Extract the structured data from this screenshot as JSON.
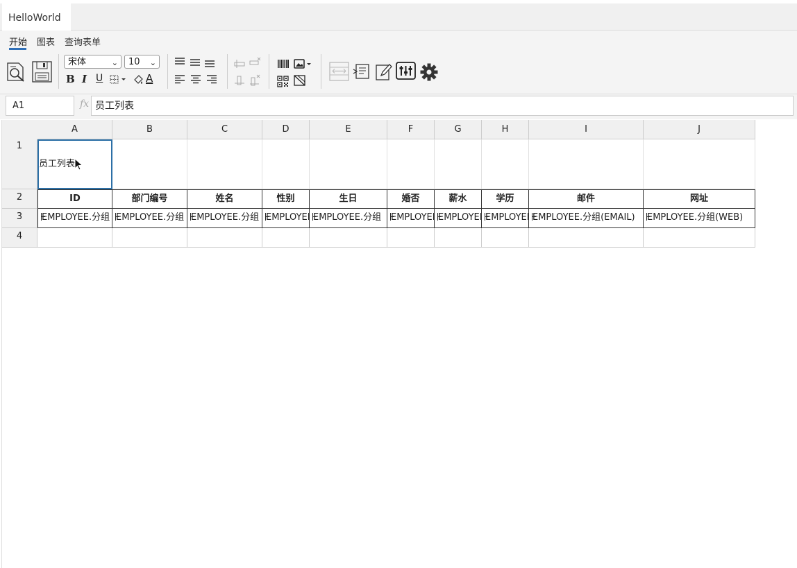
{
  "window": {
    "doc_tab": "HelloWorld"
  },
  "ribbon": {
    "tabs": [
      "开始",
      "图表",
      "查询表单"
    ],
    "active_index": 0
  },
  "toolbar": {
    "font_name": "宋体",
    "font_size": "10",
    "bold": "B",
    "italic": "I",
    "underline": "U",
    "font_color": "A",
    "icons": [
      "preview-icon",
      "save-icon",
      "align-top-icon",
      "align-middle-icon",
      "align-bottom-icon",
      "align-left-icon",
      "align-center-icon",
      "align-right-icon",
      "insert-row-icon",
      "delete-row-icon",
      "insert-col-icon",
      "delete-col-icon",
      "barcode-icon",
      "image-icon",
      "qrcode-icon",
      "slash-icon",
      "merge-icon",
      "datasource-icon",
      "edit-icon",
      "params-icon",
      "settings-icon"
    ]
  },
  "formula_bar": {
    "cell_ref": "A1",
    "fx": "fx",
    "content": "员工列表"
  },
  "sheet": {
    "columns": [
      "A",
      "B",
      "C",
      "D",
      "E",
      "F",
      "G",
      "H",
      "I",
      "J"
    ],
    "rows": [
      "1",
      "2",
      "3",
      "4"
    ],
    "a1_text": "员工列表",
    "headers": [
      "ID",
      "部门编号",
      "姓名",
      "性别",
      "生日",
      "婚否",
      "薪水",
      "学历",
      "邮件",
      "网址"
    ],
    "data_row": [
      "EMPLOYEE.分组",
      "EMPLOYEE.分组",
      "EMPLOYEE.分组",
      "EMPLOYEE.分组",
      "EMPLOYEE.分组",
      "EMPLOYEE.分组",
      "EMPLOYEE.分组",
      "EMPLOYEE.分组",
      "EMPLOYEE.分组(EMAIL)",
      "EMPLOYEE.分组(WEB)"
    ]
  },
  "colors": {
    "accent": "#2f6fb7",
    "selection": "#2c6fa6"
  }
}
